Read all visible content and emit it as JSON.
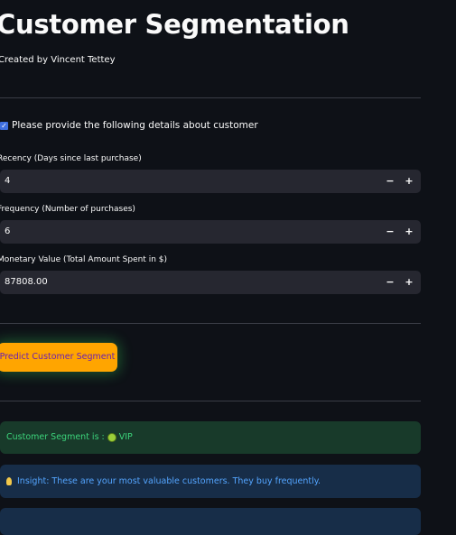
{
  "header": {
    "title": "Customer Segmentation",
    "subtitle": "Created by Vincent Tettey"
  },
  "form": {
    "prompt": "Please provide the following details about customer",
    "prompt_icon": "checkbox-icon",
    "fields": [
      {
        "label": "Recency (Days since last purchase)",
        "value": "4"
      },
      {
        "label": "Frequency (Number of purchases)",
        "value": "6"
      },
      {
        "label": "Monetary Value (Total Amount Spent in $)",
        "value": "87808.00"
      }
    ],
    "minus_glyph": "−",
    "plus_glyph": "+"
  },
  "actions": {
    "predict_label": "Predict Customer Segment"
  },
  "results": {
    "segment_prefix": "Customer Segment is :",
    "segment_value": "VIP",
    "insight": "Insight: These are your most valuable customers. They buy frequently."
  },
  "colors": {
    "background": "#0e1117",
    "button": "#ffa500",
    "success_bg": "#183a2a",
    "success_text": "#3cd47b",
    "info_bg": "#172d48",
    "info_text": "#54a5ff"
  }
}
